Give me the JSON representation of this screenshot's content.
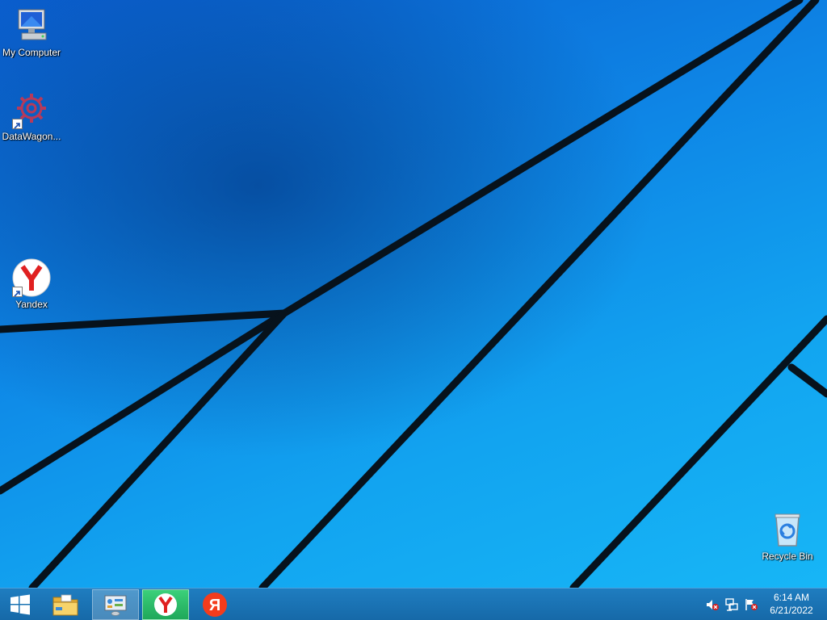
{
  "desktop": {
    "icons": [
      {
        "label": "My Computer",
        "icon": "computer-icon"
      },
      {
        "label": "DataWagon...",
        "icon": "gear-icon"
      },
      {
        "label": "Yandex",
        "icon": "yandex-browser-icon"
      },
      {
        "label": "Recycle Bin",
        "icon": "recycle-bin-icon"
      }
    ]
  },
  "taskbar": {
    "buttons": [
      {
        "name": "start-button",
        "icon": "windows-logo-icon"
      },
      {
        "name": "file-explorer",
        "icon": "folder-icon"
      },
      {
        "name": "system-info",
        "icon": "control-panel-icon"
      },
      {
        "name": "yandex-browser",
        "icon": "yandex-browser-icon",
        "active": true
      },
      {
        "name": "yandex",
        "icon": "yandex-ya-icon"
      }
    ],
    "tray": {
      "icons": [
        "speaker-muted-icon",
        "network-icon",
        "action-center-flag-icon"
      ],
      "time": "6:14 AM",
      "date": "6/21/2022"
    }
  },
  "colors": {
    "taskbar": "#1669a8",
    "yandex_red": "#e02020",
    "yandex_active_bg": "#1fa85a"
  }
}
